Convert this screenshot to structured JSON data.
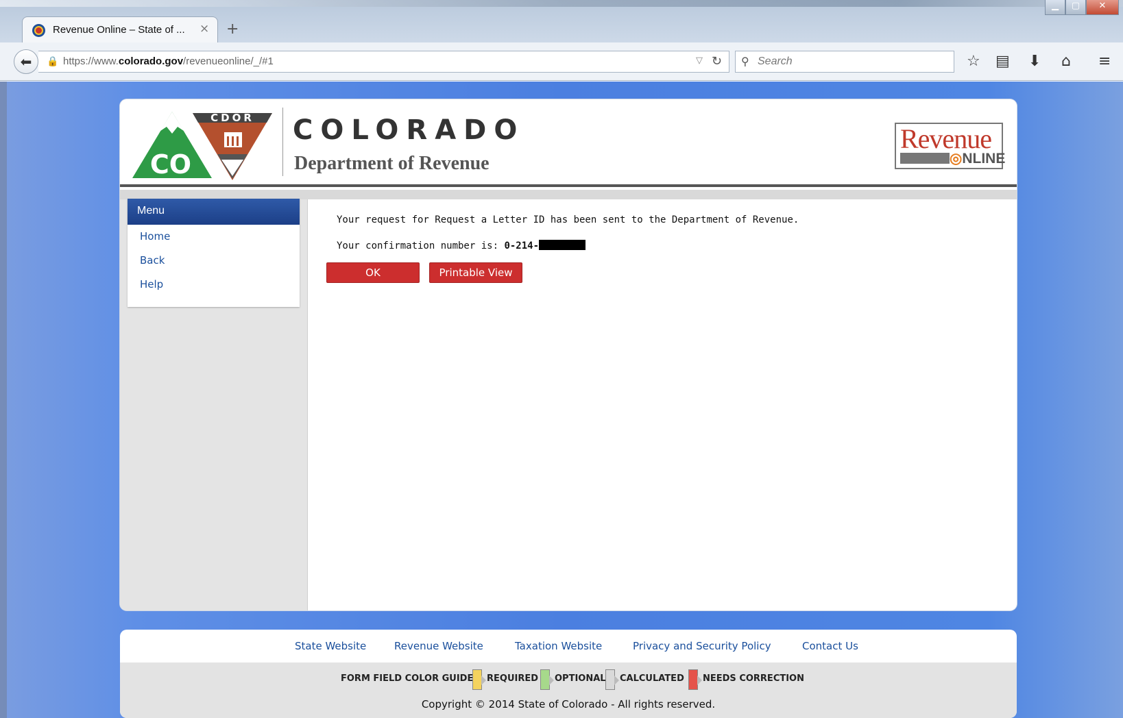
{
  "browser": {
    "tab_title": "Revenue Online – State of ...",
    "tab_close": "×",
    "new_tab": "+",
    "url_prefix": "https://www.",
    "url_domain": "colorado.gov",
    "url_path": "/revenueonline/_/#1",
    "search_placeholder": "Search",
    "icons": [
      "back-arrow-icon",
      "lock-icon",
      "reload-icon",
      "search-icon",
      "bookmark-star-icon",
      "reading-list-icon",
      "download-icon",
      "home-icon",
      "menu-icon"
    ]
  },
  "header": {
    "logo_text": "CDOR",
    "logo_co": "CO",
    "state_name": "COLORADO",
    "dept_name": "Department of Revenue",
    "revenue_logo_word": "Revenue",
    "revenue_logo_online": "NLINE"
  },
  "menu": {
    "title": "Menu",
    "items": [
      {
        "label": "Home"
      },
      {
        "label": "Back"
      },
      {
        "label": "Help"
      }
    ]
  },
  "content": {
    "message": "Your request for Request a Letter ID has been sent to the Department of Revenue.",
    "confirmation_label": "Your confirmation number is: ",
    "confirmation_number": "0-214-",
    "ok_button": "OK",
    "printable_button": "Printable View"
  },
  "footer": {
    "links": [
      {
        "label": "State Website"
      },
      {
        "label": "Revenue Website"
      },
      {
        "label": "Taxation Website"
      },
      {
        "label": "Privacy and Security Policy"
      },
      {
        "label": "Contact Us"
      }
    ],
    "color_guide_label": "FORM FIELD COLOR GUIDE:",
    "guide_items": [
      {
        "label": "REQUIRED",
        "color": "#f4d35e"
      },
      {
        "label": "OPTIONAL",
        "color": "#a7d98b"
      },
      {
        "label": "CALCULATED",
        "color": "#d9d9d9"
      },
      {
        "label": "NEEDS CORRECTION",
        "color": "#e5534b"
      }
    ],
    "copyright": "Copyright © 2014 State of Colorado - All rights reserved."
  },
  "colors": {
    "accent_red": "#cc2e2e",
    "link_blue": "#1a4f9c",
    "menu_header": "#1c3f87"
  }
}
